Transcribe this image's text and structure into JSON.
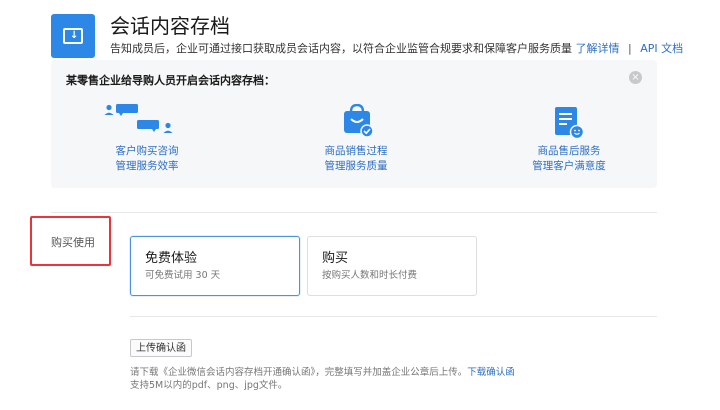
{
  "header": {
    "title": "会话内容存档",
    "description": "告知成员后，企业可通过接口获取成员会话内容，以符合企业监管合规要求和保障客户服务质量",
    "learn_more_link": "了解详情",
    "separator": "|",
    "api_docs_link": "API 文档"
  },
  "example_card": {
    "heading": "某零售企业给导购人员开启会话内容存档：",
    "features": [
      {
        "icon": "chat-people-icon",
        "line1": "客户购买咨询",
        "line2": "管理服务效率"
      },
      {
        "icon": "shopping-bag-check-icon",
        "line1": "商品销售过程",
        "line2": "管理服务质量"
      },
      {
        "icon": "document-smile-icon",
        "line1": "商品售后服务",
        "line2": "管理客户满意度"
      }
    ]
  },
  "purchase_section": {
    "label": "购买使用",
    "options": [
      {
        "title": "免费体验",
        "subtitle": "可免费试用 30 天",
        "selected": true
      },
      {
        "title": "购买",
        "subtitle": "按购买人数和时长付费",
        "selected": false
      }
    ]
  },
  "upload": {
    "button_label": "上传确认函",
    "note_prefix": "请下载《企业微信会话内容存档开通确认函》，完整填写并加盖企业公章后上传。",
    "download_link": "下载确认函",
    "note_line2": "支持5M以内的pdf、png、jpg文件。"
  },
  "colors": {
    "brand_blue": "#2d87e6",
    "link_blue": "#2d6fc4",
    "highlight_red": "#e8343a",
    "selected_border": "#4b93e0"
  }
}
